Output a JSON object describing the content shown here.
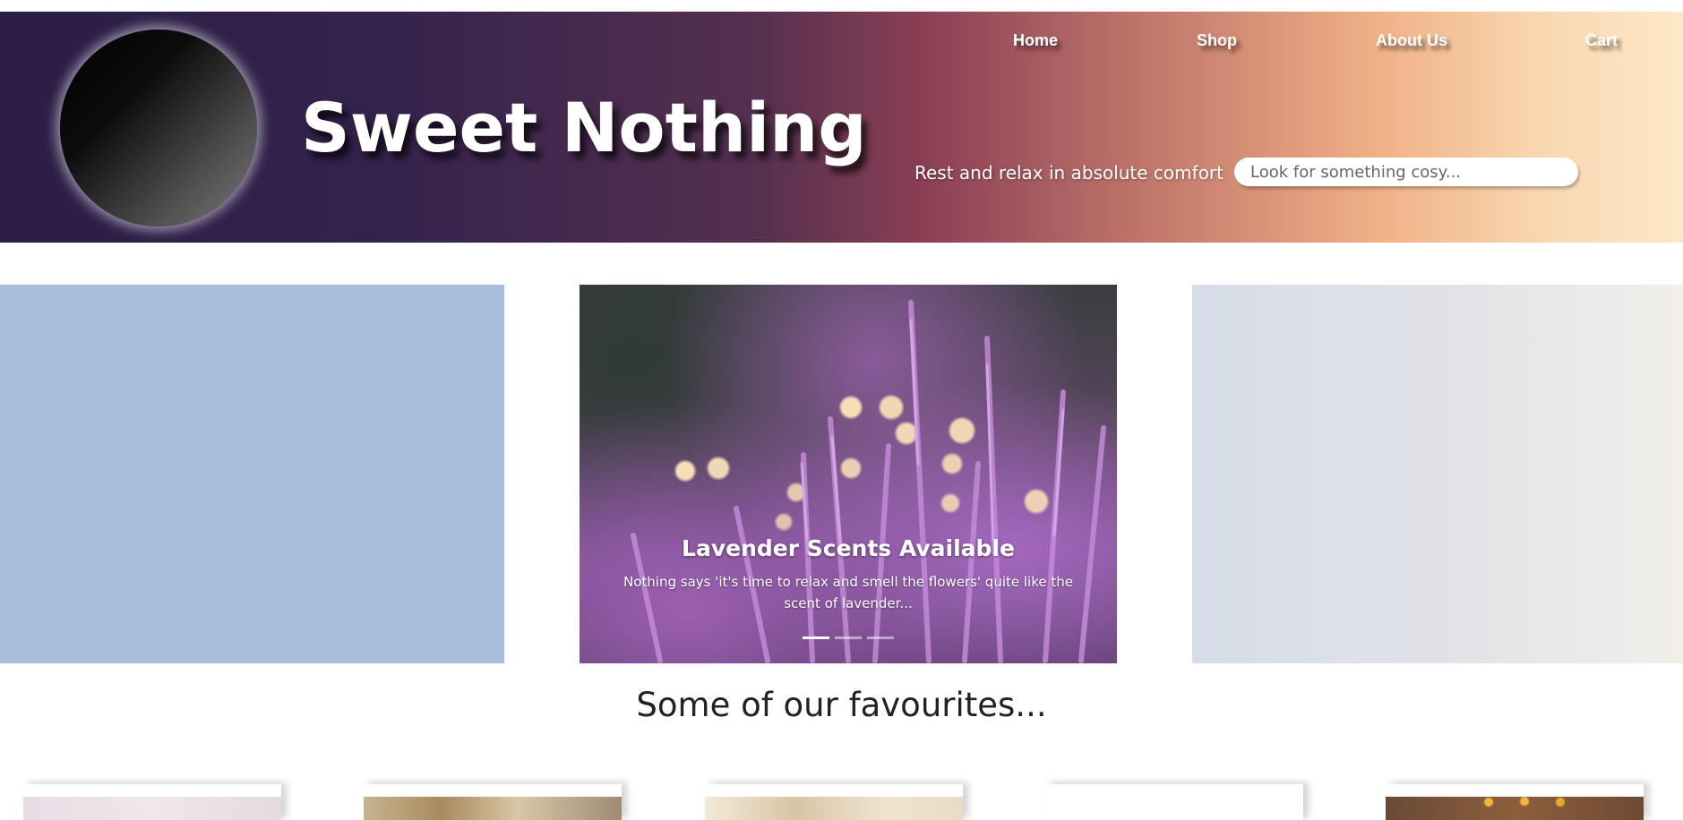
{
  "header": {
    "title": "Sweet Nothing",
    "tagline": "Rest and relax in absolute comfort",
    "search_placeholder": "Look for something cosy..."
  },
  "nav": {
    "items": [
      {
        "label": "Home"
      },
      {
        "label": "Shop"
      },
      {
        "label": "About Us"
      },
      {
        "label": "Cart"
      }
    ]
  },
  "carousel": {
    "active_slide": {
      "title": "Lavender Scents Available",
      "text": "Nothing says 'it's time to relax and smell the flowers' quite like the scent of lavender..."
    },
    "indicator_count": 3,
    "active_index": 0
  },
  "favourites": {
    "heading": "Some of our favourites..."
  },
  "colors": {
    "header_gradient_start": "#2b1d45",
    "header_gradient_mid": "#8b3f55",
    "header_gradient_end": "#fde8c8",
    "left_slide": "#a9bedc",
    "heading_text": "#222222"
  }
}
